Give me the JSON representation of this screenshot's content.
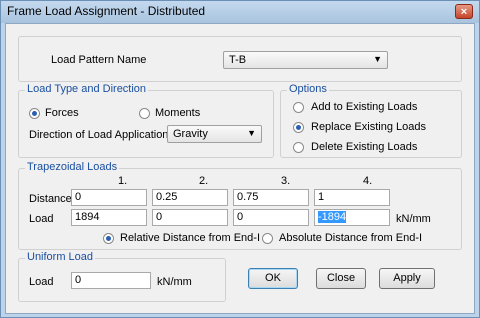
{
  "window": {
    "title": "Frame Load Assignment - Distributed",
    "close_glyph": "×"
  },
  "load_pattern": {
    "label": "Load Pattern Name",
    "value": "T-B"
  },
  "load_type": {
    "title": "Load Type and Direction",
    "forces_label": "Forces",
    "moments_label": "Moments",
    "selected": "Forces",
    "direction_label": "Direction of Load Application",
    "direction_value": "Gravity"
  },
  "options": {
    "title": "Options",
    "items": [
      "Add to Existing Loads",
      "Replace Existing Loads",
      "Delete Existing Loads"
    ],
    "selected": "Replace Existing Loads"
  },
  "trapezoidal": {
    "title": "Trapezoidal Loads",
    "col_headers": [
      "1.",
      "2.",
      "3.",
      "4."
    ],
    "distance_label": "Distance",
    "distances": [
      "0",
      "0.25",
      "0.75",
      "1"
    ],
    "load_label": "Load",
    "loads": [
      "1894",
      "0",
      "0",
      "-1894"
    ],
    "unit": "kN/mm",
    "relative_label": "Relative Distance from End-I",
    "absolute_label": "Absolute Distance from End-I",
    "selected": "Relative Distance from End-I"
  },
  "uniform": {
    "title": "Uniform Load",
    "load_label": "Load",
    "value": "0",
    "unit": "kN/mm"
  },
  "buttons": {
    "ok": "OK",
    "close": "Close",
    "apply": "Apply"
  }
}
